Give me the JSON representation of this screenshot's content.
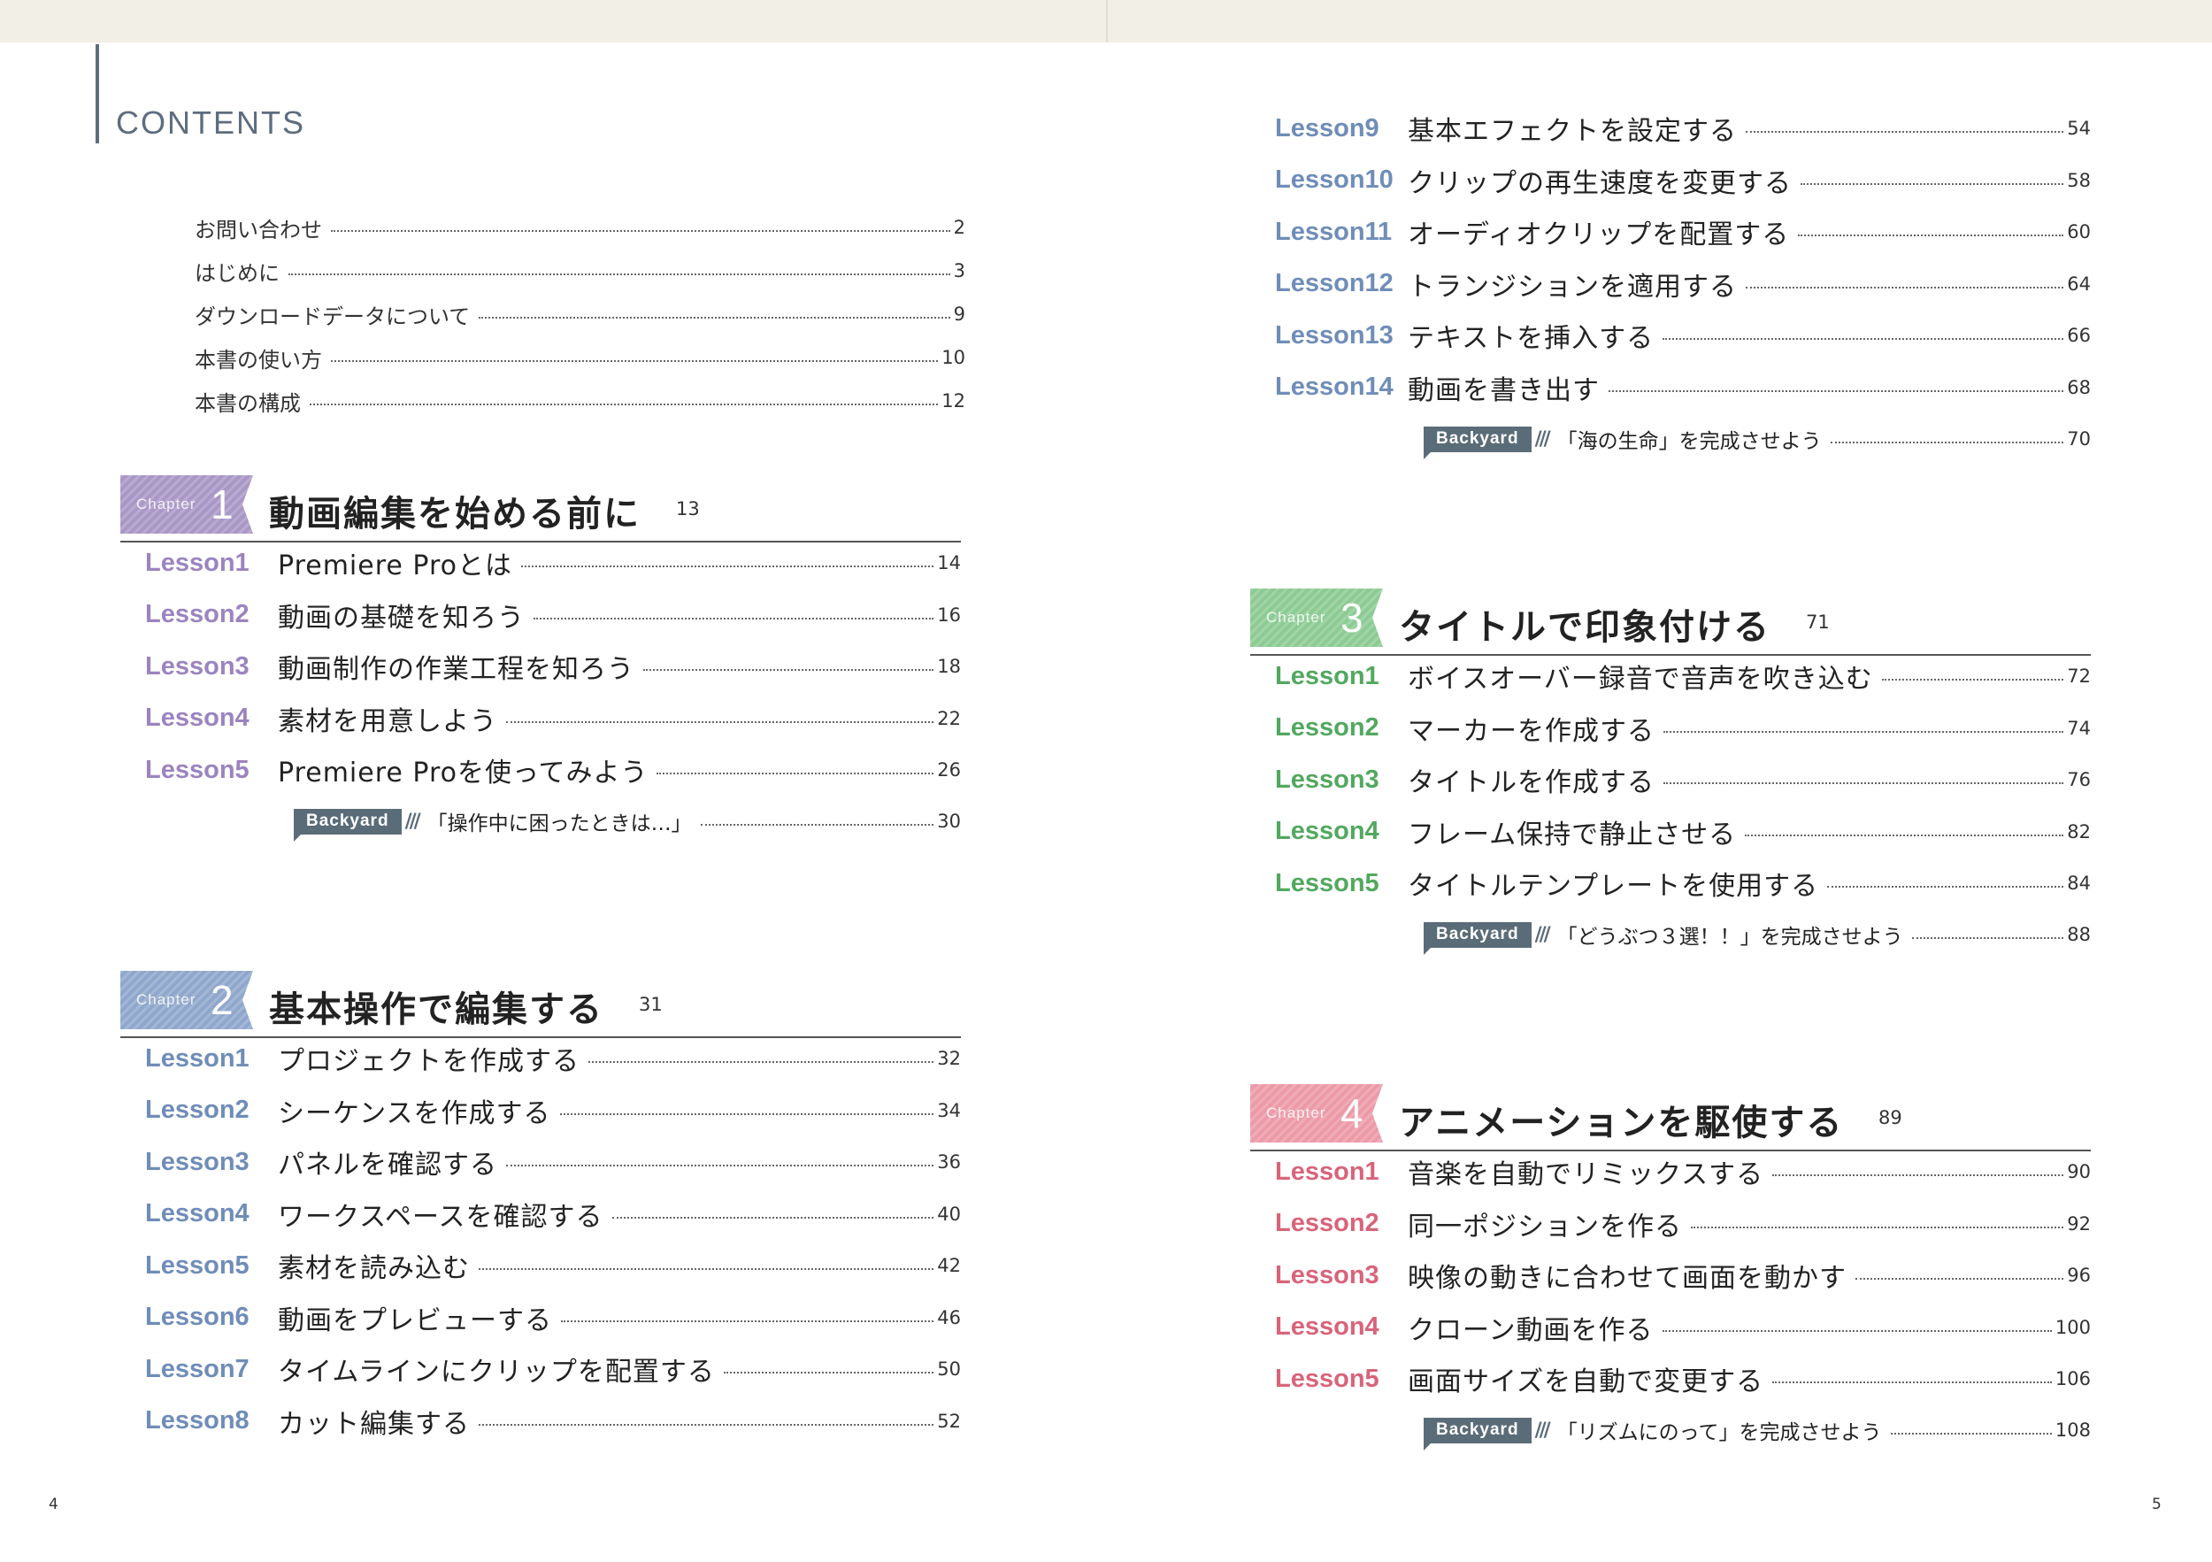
{
  "header": {
    "contents_label": "CONTENTS"
  },
  "front_matter": [
    {
      "title": "お問い合わせ",
      "page": "2"
    },
    {
      "title": "はじめに",
      "page": "3"
    },
    {
      "title": "ダウンロードデータについて",
      "page": "9"
    },
    {
      "title": "本書の使い方",
      "page": "10"
    },
    {
      "title": "本書の構成",
      "page": "12"
    }
  ],
  "chapter_word": "Chapter",
  "chapters": [
    {
      "num": "1",
      "title": "動画編集を始める前に",
      "page": "13",
      "color": "#a997c6",
      "lessons": [
        {
          "label": "Lesson1",
          "title": "Premiere Proとは",
          "page": "14"
        },
        {
          "label": "Lesson2",
          "title": "動画の基礎を知ろう",
          "page": "16"
        },
        {
          "label": "Lesson3",
          "title": "動画制作の作業工程を知ろう",
          "page": "18"
        },
        {
          "label": "Lesson4",
          "title": "素材を用意しよう",
          "page": "22"
        },
        {
          "label": "Lesson5",
          "title": "Premiere Proを使ってみよう",
          "page": "26"
        }
      ],
      "backyard": {
        "tag": "Backyard",
        "title": "「操作中に困ったときは…」",
        "page": "30"
      }
    },
    {
      "num": "2",
      "title": "基本操作で編集する",
      "page": "31",
      "color": "#8fa7cc",
      "lessons": [
        {
          "label": "Lesson1",
          "title": "プロジェクトを作成する",
          "page": "32"
        },
        {
          "label": "Lesson2",
          "title": "シーケンスを作成する",
          "page": "34"
        },
        {
          "label": "Lesson3",
          "title": "パネルを確認する",
          "page": "36"
        },
        {
          "label": "Lesson4",
          "title": "ワークスペースを確認する",
          "page": "40"
        },
        {
          "label": "Lesson5",
          "title": "素材を読み込む",
          "page": "42"
        },
        {
          "label": "Lesson6",
          "title": "動画をプレビューする",
          "page": "46"
        },
        {
          "label": "Lesson7",
          "title": "タイムラインにクリップを配置する",
          "page": "50"
        },
        {
          "label": "Lesson8",
          "title": "カット編集する",
          "page": "52"
        },
        {
          "label": "Lesson9",
          "title": "基本エフェクトを設定する",
          "page": "54"
        },
        {
          "label": "Lesson10",
          "title": "クリップの再生速度を変更する",
          "page": "58"
        },
        {
          "label": "Lesson11",
          "title": "オーディオクリップを配置する",
          "page": "60"
        },
        {
          "label": "Lesson12",
          "title": "トランジションを適用する",
          "page": "64"
        },
        {
          "label": "Lesson13",
          "title": "テキストを挿入する",
          "page": "66"
        },
        {
          "label": "Lesson14",
          "title": "動画を書き出す",
          "page": "68"
        }
      ],
      "backyard": {
        "tag": "Backyard",
        "title": "「海の生命」を完成させよう",
        "page": "70"
      }
    },
    {
      "num": "3",
      "title": "タイトルで印象付ける",
      "page": "71",
      "color": "#8ccb93",
      "lessons": [
        {
          "label": "Lesson1",
          "title": "ボイスオーバー録音で音声を吹き込む",
          "page": "72"
        },
        {
          "label": "Lesson2",
          "title": "マーカーを作成する",
          "page": "74"
        },
        {
          "label": "Lesson3",
          "title": "タイトルを作成する",
          "page": "76"
        },
        {
          "label": "Lesson4",
          "title": "フレーム保持で静止させる",
          "page": "82"
        },
        {
          "label": "Lesson5",
          "title": "タイトルテンプレートを使用する",
          "page": "84"
        }
      ],
      "backyard": {
        "tag": "Backyard",
        "title": "「どうぶつ３選！！」を完成させよう",
        "page": "88"
      }
    },
    {
      "num": "4",
      "title": "アニメーションを駆使する",
      "page": "89",
      "color": "#ec9aa7",
      "lessons": [
        {
          "label": "Lesson1",
          "title": "音楽を自動でリミックスする",
          "page": "90"
        },
        {
          "label": "Lesson2",
          "title": "同一ポジションを作る",
          "page": "92"
        },
        {
          "label": "Lesson3",
          "title": "映像の動きに合わせて画面を動かす",
          "page": "96"
        },
        {
          "label": "Lesson4",
          "title": "クローン動画を作る",
          "page": "100"
        },
        {
          "label": "Lesson5",
          "title": "画面サイズを自動で変更する",
          "page": "106"
        }
      ],
      "backyard": {
        "tag": "Backyard",
        "title": "「リズムにのって」を完成させよう",
        "page": "108"
      }
    }
  ],
  "lesson_label_colors": {
    "ch1": "#9b84bf",
    "ch2": "#6f8db8",
    "ch3": "#52a85f",
    "ch4": "#d8647a"
  },
  "folio": {
    "left": "4",
    "right": "5"
  }
}
